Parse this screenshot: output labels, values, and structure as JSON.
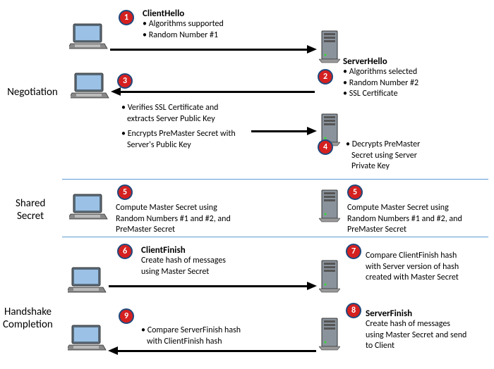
{
  "phases": {
    "negotiation": "Negotiation",
    "shared_secret_1": "Shared",
    "shared_secret_2": "Secret",
    "handshake_1": "Handshake",
    "handshake_2": "Completion"
  },
  "steps": {
    "1": {
      "num": "1",
      "title": "ClientHello",
      "b1": "• Algorithms supported",
      "b2": "• Random Number #1"
    },
    "2": {
      "num": "2",
      "title": "ServerHello",
      "b1": "• Algorithms selected",
      "b2": "• Random Number #2",
      "b3": "• SSL Certificate"
    },
    "3": {
      "num": "3",
      "b1": "• Verifies SSL Certificate and",
      "b1b": "extracts Server Public Key",
      "b2": "• Encrypts PreMaster Secret with",
      "b2b": "Server's Public Key"
    },
    "4": {
      "num": "4",
      "b1": "• Decrypts PreMaster",
      "b1b": "Secret using Server",
      "b1c": "Private Key"
    },
    "5a": {
      "num": "5",
      "b1": "Compute Master Secret using",
      "b2": "Random Numbers #1 and #2, and",
      "b3": "PreMaster Secret"
    },
    "5b": {
      "num": "5",
      "b1": "Compute Master Secret using",
      "b2": "Random Numbers #1 and #2, and",
      "b3": "PreMaster Secret"
    },
    "6": {
      "num": "6",
      "title": "ClientFinish",
      "b1": "Create hash of messages",
      "b2": "using Master Secret"
    },
    "7": {
      "num": "7",
      "b1": "Compare ClientFinish hash",
      "b2": "with Server version of hash",
      "b3": "created with Master Secret"
    },
    "8": {
      "num": "8",
      "title": "ServerFinish",
      "b1": "Create hash of messages",
      "b2": "using Master Secret and send",
      "b3": "to Client"
    },
    "9": {
      "num": "9",
      "b1": "• Compare ServerFinish hash",
      "b2": "with ClientFinish hash"
    }
  }
}
